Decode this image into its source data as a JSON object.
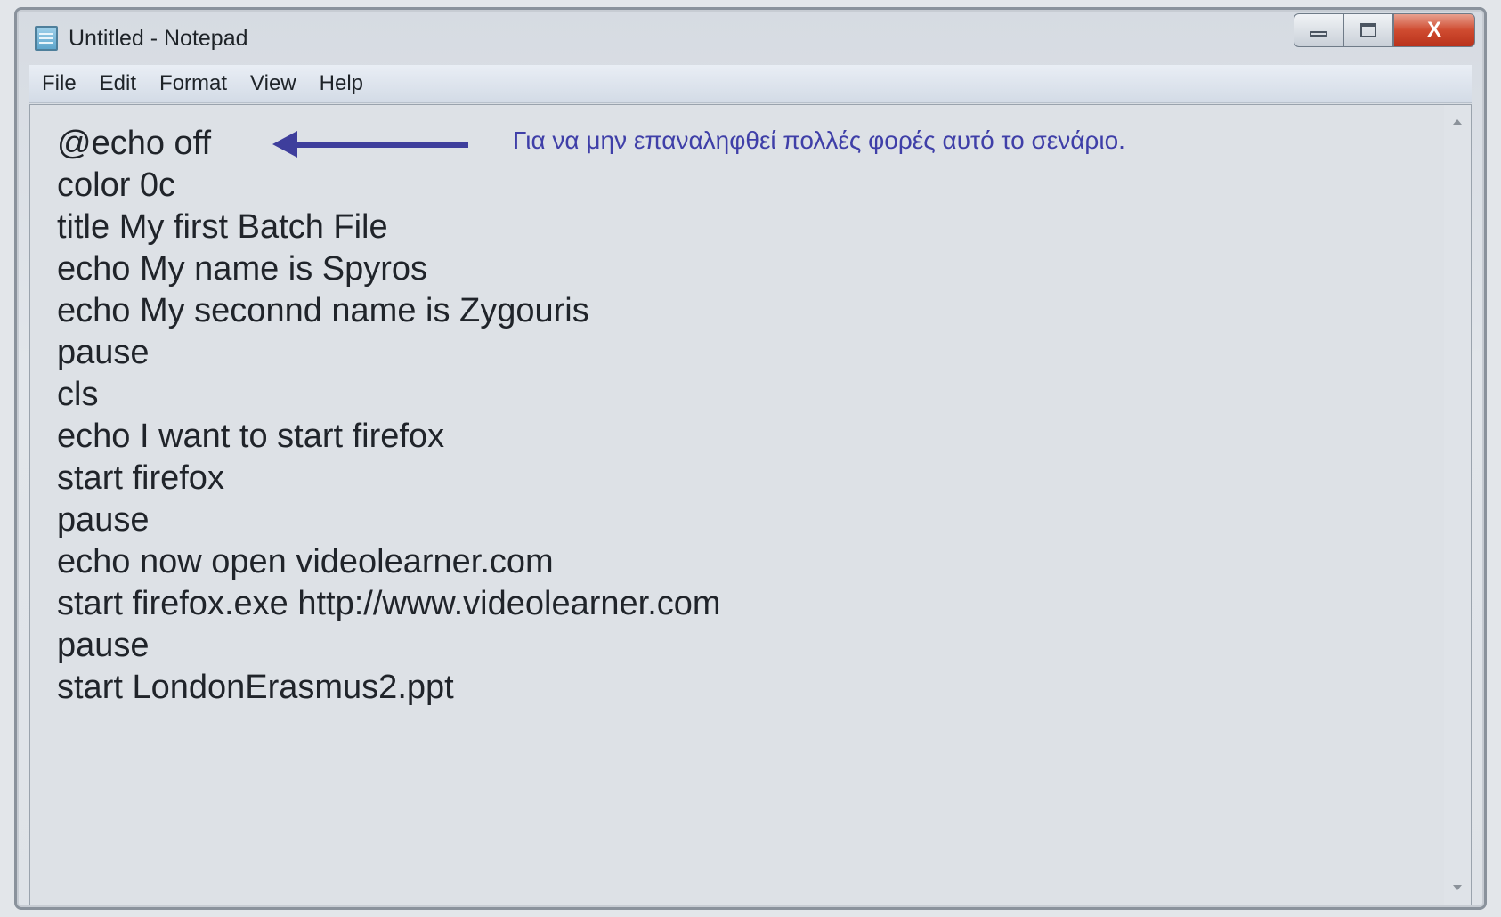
{
  "window": {
    "title": "Untitled - Notepad"
  },
  "icons": {
    "app": "notepad-icon",
    "minimize": "minimize-icon",
    "maximize": "maximize-icon",
    "close": "close-icon",
    "annotation_arrow": "left-arrow-icon"
  },
  "menu": {
    "items": [
      "File",
      "Edit",
      "Format",
      "View",
      "Help"
    ]
  },
  "controls": {
    "close_label": "X"
  },
  "editor": {
    "lines": [
      "@echo off",
      "color 0c",
      "title My first Batch File",
      "echo My name is Spyros",
      "echo My seconnd name is Zygouris",
      "pause",
      "cls",
      "echo I want to start firefox",
      "start firefox",
      "pause",
      "echo now open videolearner.com",
      "start firefox.exe http://www.videolearner.com",
      "pause",
      "start LondonErasmus2.ppt"
    ]
  },
  "annotation": {
    "text": "Για να μην επαναληφθεί πολλές φορές αυτό το σενάριο."
  },
  "colors": {
    "annotation": "#3f3fa8",
    "arrow": "#3e3e9c",
    "close_button": "#cf4b30"
  }
}
